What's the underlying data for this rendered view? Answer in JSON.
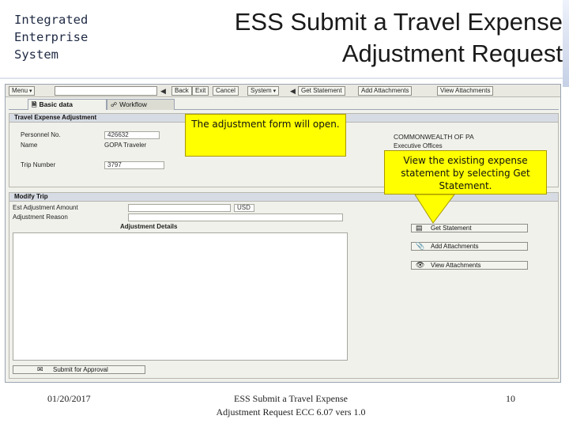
{
  "brand": {
    "line1": "Integrated",
    "line2": "Enterprise",
    "line3": "System"
  },
  "title": {
    "line1": "ESS Submit a Travel Expense",
    "line2": "Adjustment Request"
  },
  "toolbar": {
    "menu": "Menu",
    "back": "Back",
    "exit": "Exit",
    "cancel": "Cancel",
    "system": "System",
    "get_statement": "Get Statement",
    "add_attachments": "Add Attachments",
    "view_attachments": "View Attachments"
  },
  "tabs": [
    {
      "label": "Basic data",
      "icon": "document-icon"
    },
    {
      "label": "Workflow",
      "icon": "workflow-icon"
    }
  ],
  "travel_adjustment": {
    "heading": "Travel Expense Adjustment",
    "personnel_label": "Personnel No.",
    "personnel_value": "426632",
    "name_label": "Name",
    "name_value": "GOPA Traveler",
    "org_line1": "COMMONWEALTH OF PA",
    "org_line2": "Executive Offices",
    "trip_label": "Trip Number",
    "trip_value": "3797"
  },
  "modify_trip": {
    "heading": "Modify Trip",
    "amount_label": "Est Adjustment Amount",
    "currency": "USD",
    "reason_label": "Adjustment Reason",
    "details_heading": "Adjustment Details"
  },
  "buttons": {
    "get_statement": "Get Statement",
    "add_attachments": "Add Attachments",
    "view_attachments": "View Attachments",
    "submit": "Submit for Approval"
  },
  "callouts": {
    "form_open": "The adjustment form will open.",
    "view_statement": "View the existing expense statement by selecting Get Statement."
  },
  "footer": {
    "date": "01/20/2017",
    "doc_line1": "ESS Submit a Travel Expense",
    "doc_line2": "Adjustment Request ECC 6.07 vers 1.0",
    "page": "10"
  }
}
